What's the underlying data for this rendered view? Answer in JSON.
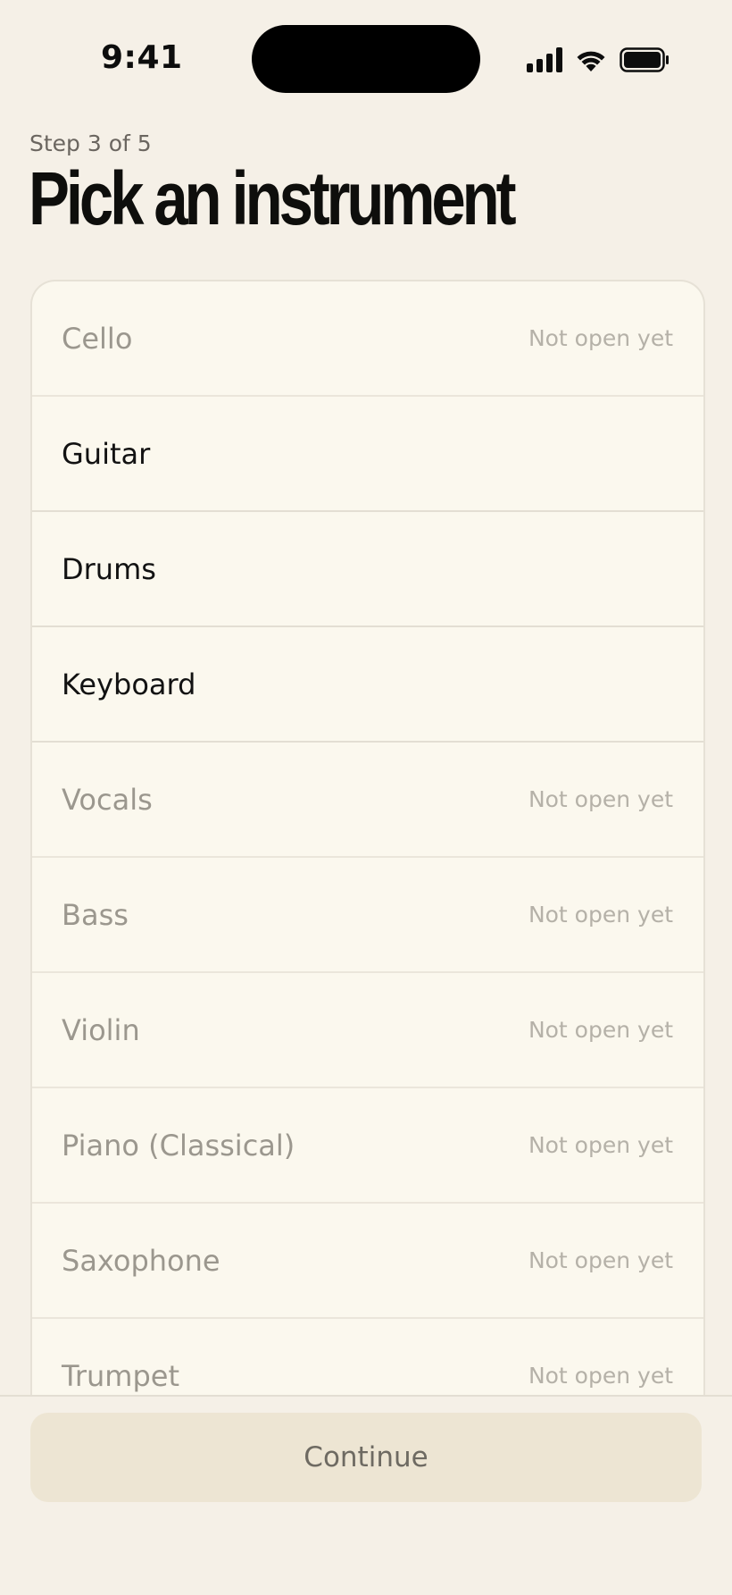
{
  "status_bar": {
    "time": "9:41",
    "icons": [
      "cellular-signal-icon",
      "wifi-icon",
      "battery-icon"
    ]
  },
  "header": {
    "step": "Step 3 of 5",
    "title": "Pick an instrument"
  },
  "instruments": [
    {
      "label": "Cello",
      "status": "Not open yet",
      "available": false
    },
    {
      "label": "Guitar",
      "status": "",
      "available": true
    },
    {
      "label": "Drums",
      "status": "",
      "available": true
    },
    {
      "label": "Keyboard",
      "status": "",
      "available": true
    },
    {
      "label": "Vocals",
      "status": "Not open yet",
      "available": false
    },
    {
      "label": "Bass",
      "status": "Not open yet",
      "available": false
    },
    {
      "label": "Violin",
      "status": "Not open yet",
      "available": false
    },
    {
      "label": "Piano (Classical)",
      "status": "Not open yet",
      "available": false
    },
    {
      "label": "Saxophone",
      "status": "Not open yet",
      "available": false
    },
    {
      "label": "Trumpet",
      "status": "Not open yet",
      "available": false
    }
  ],
  "footer": {
    "continue_label": "Continue"
  },
  "colors": {
    "background": "#f5f0e7",
    "card": "#fbf8ee",
    "disabled_text": "#9b978e",
    "button_bg": "#ede5d3"
  }
}
